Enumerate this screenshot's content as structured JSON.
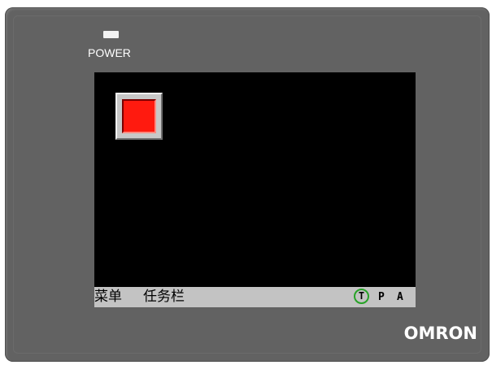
{
  "device": {
    "power_label": "POWER",
    "brand": "OMRON",
    "bezel_color": "#626262",
    "led_color": "#f2f2f2"
  },
  "screen": {
    "background": "#000000",
    "button": {
      "icon": "red-square-button-icon",
      "face_color": "#ff1a0f"
    },
    "taskbar": {
      "menu_label": "菜单",
      "taskbar_label": "任务栏",
      "indicators": [
        "T",
        "P",
        "A"
      ],
      "indicator_ring_color": "#27a327",
      "background": "#c3c3c3"
    }
  }
}
